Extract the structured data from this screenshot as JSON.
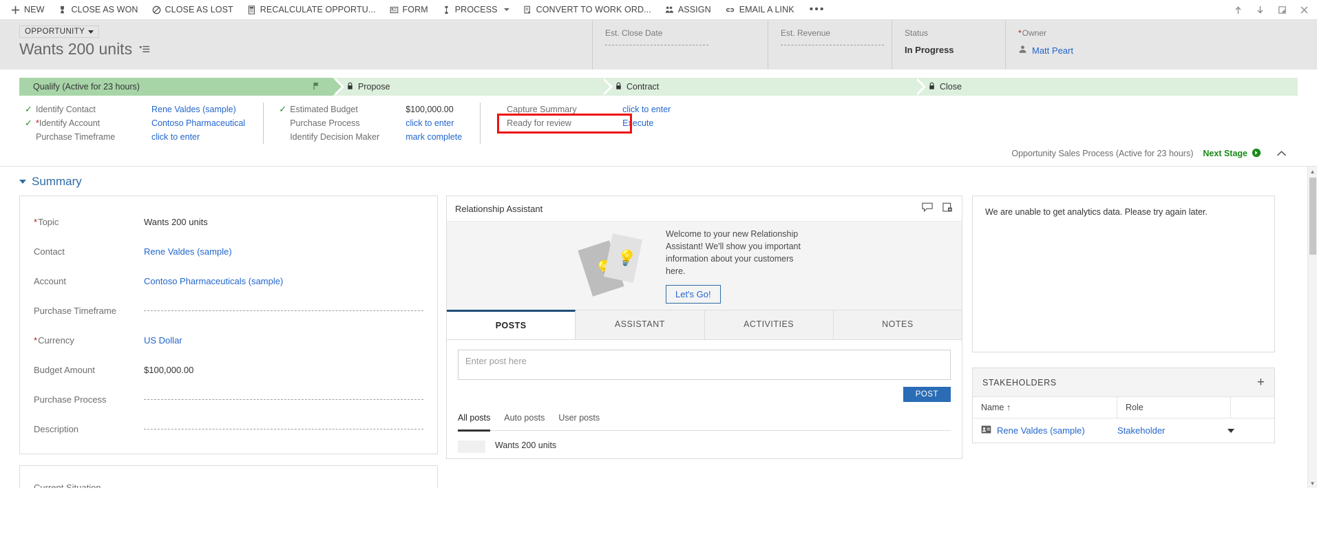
{
  "command_bar": {
    "items": [
      {
        "label": "NEW",
        "icon": "plus-icon",
        "has_caret": false
      },
      {
        "label": "CLOSE AS WON",
        "icon": "trophy-icon",
        "has_caret": false
      },
      {
        "label": "CLOSE AS LOST",
        "icon": "no-entry-icon",
        "has_caret": false
      },
      {
        "label": "RECALCULATE OPPORTU...",
        "icon": "calculator-icon",
        "has_caret": false
      },
      {
        "label": "FORM",
        "icon": "form-icon",
        "has_caret": false
      },
      {
        "label": "PROCESS",
        "icon": "process-icon",
        "has_caret": true
      },
      {
        "label": "CONVERT TO WORK ORD...",
        "icon": "convert-icon",
        "has_caret": false
      },
      {
        "label": "ASSIGN",
        "icon": "assign-users-icon",
        "has_caret": false
      },
      {
        "label": "EMAIL A LINK",
        "icon": "link-icon",
        "has_caret": false
      }
    ],
    "overflow_label": "•••",
    "window_controls": [
      {
        "name": "previous-record-icon",
        "glyph": "↑"
      },
      {
        "name": "next-record-icon",
        "glyph": "↓"
      },
      {
        "name": "pop-out-icon",
        "glyph": "↗"
      },
      {
        "name": "close-icon",
        "glyph": "✕"
      }
    ]
  },
  "record_header": {
    "entity_type": "OPPORTUNITY",
    "title": "Wants 200 units",
    "fields": [
      {
        "label": "Est. Close Date",
        "value": "",
        "required": false,
        "empty": true
      },
      {
        "label": "Est. Revenue",
        "value": "",
        "required": false,
        "empty": true
      },
      {
        "label": "Status",
        "value": "In Progress",
        "required": false,
        "empty": false
      },
      {
        "label": "Owner",
        "value": "Matt Peart",
        "required": true,
        "empty": false,
        "is_link": true
      }
    ]
  },
  "process_flow": {
    "stages": [
      {
        "label": "Qualify (Active for 23 hours)",
        "state": "active",
        "locked": false
      },
      {
        "label": "Propose",
        "state": "inactive",
        "locked": true
      },
      {
        "label": "Contract",
        "state": "inactive",
        "locked": true
      },
      {
        "label": "Close",
        "state": "inactive",
        "locked": true
      }
    ],
    "columns": [
      {
        "rows": [
          {
            "checked": true,
            "required": false,
            "name": "Identify Contact",
            "value": "Rene Valdes (sample)",
            "is_link": true
          },
          {
            "checked": true,
            "required": true,
            "name": "Identify Account",
            "value": "Contoso Pharmaceutical",
            "is_link": true
          },
          {
            "checked": false,
            "required": false,
            "name": "Purchase Timeframe",
            "value": "click to enter",
            "is_link": true
          }
        ]
      },
      {
        "rows": [
          {
            "checked": true,
            "required": false,
            "name": "Estimated Budget",
            "value": "$100,000.00",
            "is_link": false
          },
          {
            "checked": false,
            "required": false,
            "name": "Purchase Process",
            "value": "click to enter",
            "is_link": true
          },
          {
            "checked": false,
            "required": false,
            "name": "Identify Decision Maker",
            "value": "mark complete",
            "is_link": true
          }
        ]
      },
      {
        "rows": [
          {
            "checked": false,
            "required": false,
            "name": "Capture Summary",
            "value": "click to enter",
            "is_link": true
          },
          {
            "checked": false,
            "required": false,
            "name": "Ready for review",
            "value": "Execute",
            "is_link": true,
            "highlighted": true
          }
        ]
      }
    ],
    "process_name": "Opportunity Sales Process (Active for 23 hours)",
    "next_stage_label": "Next Stage",
    "highlight_color": "#ee1111"
  },
  "summary": {
    "section_label": "Summary",
    "fields": [
      {
        "label": "Topic",
        "value": "Wants 200 units",
        "required": true,
        "is_link": false,
        "empty": false
      },
      {
        "label": "Contact",
        "value": "Rene Valdes (sample)",
        "required": false,
        "is_link": true,
        "empty": false
      },
      {
        "label": "Account",
        "value": "Contoso Pharmaceuticals (sample)",
        "required": false,
        "is_link": true,
        "empty": false
      },
      {
        "label": "Purchase Timeframe",
        "value": "",
        "required": false,
        "is_link": false,
        "empty": true
      },
      {
        "label": "Currency",
        "value": "US Dollar",
        "required": true,
        "is_link": true,
        "empty": false
      },
      {
        "label": "Budget Amount",
        "value": "$100,000.00",
        "required": false,
        "is_link": false,
        "empty": false
      },
      {
        "label": "Purchase Process",
        "value": "",
        "required": false,
        "is_link": false,
        "empty": true
      },
      {
        "label": "Description",
        "value": "",
        "required": false,
        "is_link": false,
        "empty": true
      }
    ],
    "second_card_fields": [
      {
        "label": "Current Situation",
        "value": "",
        "required": false,
        "is_link": false,
        "empty": true
      }
    ]
  },
  "relationship_assistant": {
    "title": "Relationship Assistant",
    "welcome_text": "Welcome to your new Relationship Assistant! We'll show you important information about your customers here.",
    "cta_label": "Let's Go!",
    "header_icons": [
      {
        "name": "comment-icon"
      },
      {
        "name": "add-card-icon"
      }
    ]
  },
  "social_pane": {
    "tabs": [
      {
        "label": "POSTS",
        "active": true
      },
      {
        "label": "ASSISTANT",
        "active": false
      },
      {
        "label": "ACTIVITIES",
        "active": false
      },
      {
        "label": "NOTES",
        "active": false
      }
    ],
    "post_placeholder": "Enter post here",
    "post_button_label": "POST",
    "filters": [
      {
        "label": "All posts",
        "active": true
      },
      {
        "label": "Auto posts",
        "active": false
      },
      {
        "label": "User posts",
        "active": false
      }
    ],
    "posts": [
      {
        "text": "Wants 200 units"
      }
    ]
  },
  "analytics": {
    "message": "We are unable to get analytics data. Please try again later."
  },
  "stakeholders": {
    "title": "STAKEHOLDERS",
    "add_label": "+",
    "columns": [
      {
        "label": "Name ↑"
      },
      {
        "label": "Role"
      },
      {
        "label": ""
      }
    ],
    "rows": [
      {
        "name": "Rene Valdes (sample)",
        "role": "Stakeholder"
      }
    ]
  },
  "theme": {
    "accent_blue": "#2266cc",
    "stage_active": "#a8d5a8",
    "stage_inactive": "#ddefdd",
    "post_button": "#2a6cb5",
    "required_red": "#b91a1a",
    "next_stage_green": "#1a8a1a"
  }
}
